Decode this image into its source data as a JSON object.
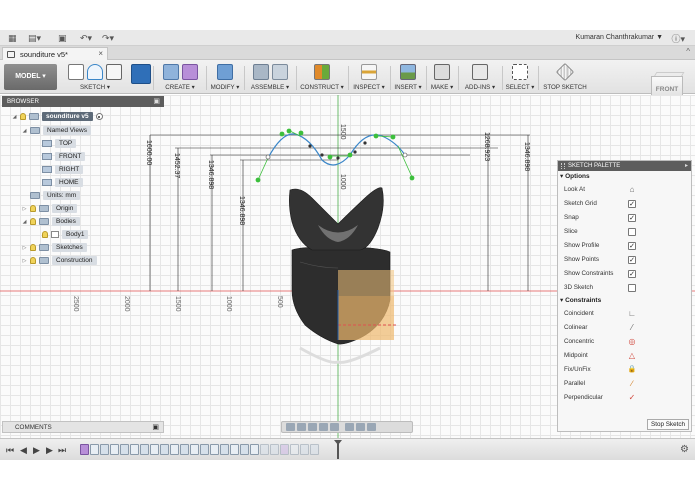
{
  "app": {
    "user_name": "Kumaran Chanthrakumar ▼",
    "icons": [
      "app-grid-icon",
      "file-icon",
      "save-icon",
      "undo-icon",
      "redo-icon",
      "help-icon"
    ]
  },
  "document_tab": {
    "title": "sounditure v5*",
    "close": "×",
    "collapse": "^"
  },
  "workspace": {
    "label": "MODEL ▾"
  },
  "toolbar": {
    "groups": [
      {
        "label": "SKETCH ▾"
      },
      {
        "label": "CREATE ▾"
      },
      {
        "label": "MODIFY ▾"
      },
      {
        "label": "ASSEMBLE ▾"
      },
      {
        "label": "CONSTRUCT ▾"
      },
      {
        "label": "INSPECT ▾"
      },
      {
        "label": "INSERT ▾"
      },
      {
        "label": "MAKE ▾"
      },
      {
        "label": "ADD-INS ▾"
      },
      {
        "label": "SELECT ▾"
      },
      {
        "label": "STOP SKETCH"
      }
    ]
  },
  "viewcube": {
    "face": "FRONT"
  },
  "browser": {
    "title": "BROWSER",
    "pin": "▣",
    "tree": [
      {
        "label": "sounditure v5",
        "level": 0,
        "expand": "◢"
      },
      {
        "label": "Named Views",
        "level": 1,
        "expand": "◢"
      },
      {
        "label": "TOP",
        "level": 2
      },
      {
        "label": "FRONT",
        "level": 2
      },
      {
        "label": "RIGHT",
        "level": 2
      },
      {
        "label": "HOME",
        "level": 2
      },
      {
        "label": "Units: mm",
        "level": 1
      },
      {
        "label": "Origin",
        "level": 1,
        "expand": "▷"
      },
      {
        "label": "Bodies",
        "level": 1,
        "expand": "◢"
      },
      {
        "label": "Body1",
        "level": 2
      },
      {
        "label": "Sketches",
        "level": 1,
        "expand": "▷"
      },
      {
        "label": "Construction",
        "level": 1,
        "expand": "▷"
      }
    ]
  },
  "dimensions": {
    "vertical": [
      "1600.00",
      "1452.37",
      "1346.898",
      "1346.898",
      "1268.923",
      "1346.898"
    ],
    "ruler": [
      "2500",
      "2000",
      "1500",
      "1000",
      "500"
    ],
    "axis": [
      "1500",
      "1000"
    ]
  },
  "sketch_palette": {
    "title": "SKETCH PALETTE",
    "expand": "▸",
    "options_header": "▾ Options",
    "options": [
      {
        "label": "Look At",
        "icon": "look-at-icon",
        "glyph": "⌂"
      },
      {
        "label": "Sketch Grid",
        "checked": "✓"
      },
      {
        "label": "Snap",
        "checked": "✓"
      },
      {
        "label": "Slice",
        "checked": ""
      },
      {
        "label": "Show Profile",
        "checked": "✓"
      },
      {
        "label": "Show Points",
        "checked": "✓"
      },
      {
        "label": "Show Constraints",
        "checked": "✓"
      },
      {
        "label": "3D Sketch",
        "checked": ""
      }
    ],
    "constraints_header": "▾ Constraints",
    "constraints": [
      {
        "label": "Coincident",
        "icon": "coincident-icon",
        "glyph": "∟",
        "color": "#666666"
      },
      {
        "label": "Colinear",
        "icon": "colinear-icon",
        "glyph": "⁄",
        "color": "#666666"
      },
      {
        "label": "Concentric",
        "icon": "concentric-icon",
        "glyph": "◎",
        "color": "#d0453a"
      },
      {
        "label": "Midpoint",
        "icon": "midpoint-icon",
        "glyph": "△",
        "color": "#d0453a"
      },
      {
        "label": "Fix/UnFix",
        "icon": "lock-icon",
        "glyph": "🔒",
        "color": "#d07a1a"
      },
      {
        "label": "Parallel",
        "icon": "parallel-icon",
        "glyph": "∕",
        "color": "#d07a1a"
      },
      {
        "label": "Perpendicular",
        "icon": "perpendicular-icon",
        "glyph": "✓",
        "color": "#d0453a"
      }
    ],
    "stop_button": "Stop Sketch"
  },
  "comments": {
    "label": "COMMENTS",
    "pin": "▣"
  },
  "timeline": {
    "controls": [
      "⏮",
      "◀",
      "▶",
      "▶",
      "⏭"
    ],
    "settings": "⚙"
  },
  "colors": {
    "accent": "#1e5aa8",
    "curve": "#3a86c8",
    "constraint_green": "#3cbf3c",
    "body": "#2b2b2b",
    "profile_fill": "#f3c27a"
  }
}
